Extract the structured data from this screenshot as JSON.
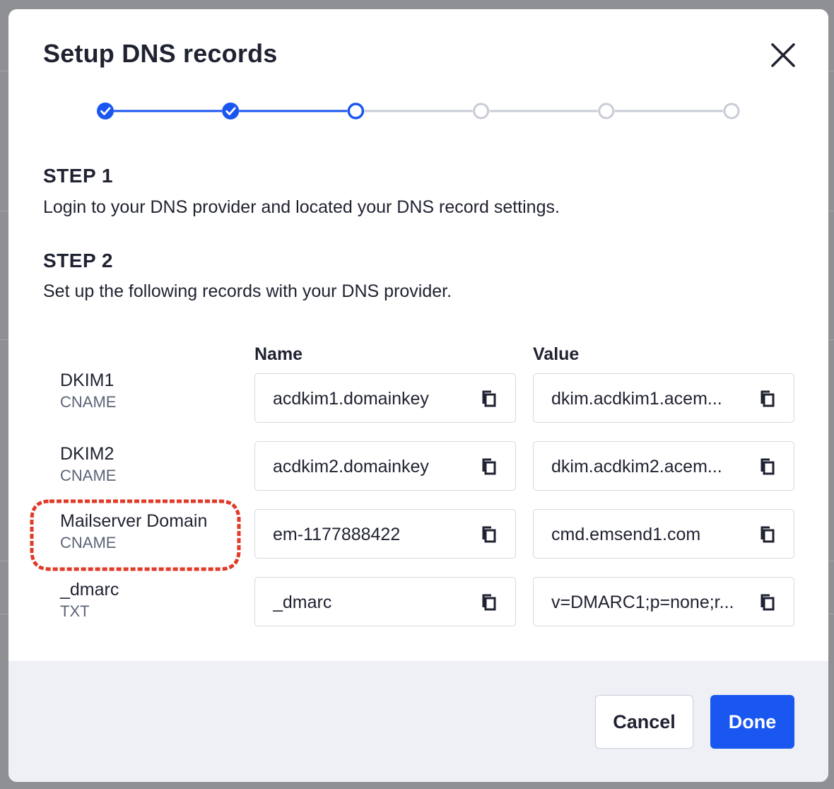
{
  "modal": {
    "title": "Setup DNS records"
  },
  "stepper": {
    "total_steps": 6,
    "completed_steps": 2,
    "current_step": 3,
    "colors": {
      "active": "#1a56f0",
      "inactive": "#c8ccd6"
    }
  },
  "step1": {
    "heading": "STEP 1",
    "text": "Login to your DNS provider and located your DNS record settings."
  },
  "step2": {
    "heading": "STEP 2",
    "text": "Set up the following records with your DNS provider."
  },
  "table": {
    "name_header": "Name",
    "value_header": "Value",
    "records": [
      {
        "label": "DKIM1",
        "type": "CNAME",
        "name": "acdkim1.domainkey",
        "value": "dkim.acdkim1.acem..."
      },
      {
        "label": "DKIM2",
        "type": "CNAME",
        "name": "acdkim2.domainkey",
        "value": "dkim.acdkim2.acem..."
      },
      {
        "label": "Mailserver Domain",
        "type": "CNAME",
        "name": "em-1177888422",
        "value": "cmd.emsend1.com"
      },
      {
        "label": "_dmarc",
        "type": "TXT",
        "name": "_dmarc",
        "value": "v=DMARC1;p=none;r..."
      }
    ]
  },
  "icons": {
    "close": "close-icon",
    "copy": "copy-icon",
    "check": "check-icon"
  },
  "annotation": {
    "highlight_color": "#e03a28"
  },
  "footer": {
    "cancel_label": "Cancel",
    "done_label": "Done"
  }
}
